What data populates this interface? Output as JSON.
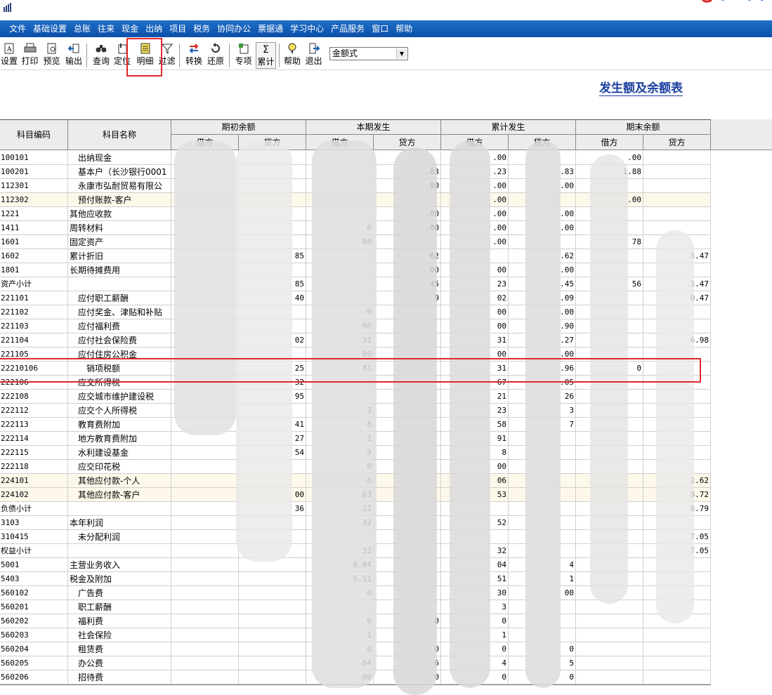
{
  "menu": [
    "文件",
    "基础设置",
    "总账",
    "往来",
    "现金",
    "出纳",
    "项目",
    "税务",
    "协同办公",
    "票据通",
    "学习中心",
    "产品服务",
    "窗口",
    "帮助"
  ],
  "toolbar": {
    "buttons": [
      {
        "label": "设置",
        "icon": "settings-icon"
      },
      {
        "label": "打印",
        "icon": "print-icon"
      },
      {
        "label": "预览",
        "icon": "preview-icon"
      },
      {
        "label": "输出",
        "icon": "export-icon"
      },
      {
        "label": "查询",
        "icon": "binoculars-icon"
      },
      {
        "label": "定位",
        "icon": "locate-icon"
      },
      {
        "label": "明细",
        "icon": "detail-icon"
      },
      {
        "label": "过滤",
        "icon": "filter-icon"
      },
      {
        "label": "转换",
        "icon": "convert-icon"
      },
      {
        "label": "还原",
        "icon": "restore-icon"
      },
      {
        "label": "专项",
        "icon": "special-icon"
      },
      {
        "label": "累计",
        "icon": "sigma-icon"
      },
      {
        "label": "帮助",
        "icon": "help-icon"
      },
      {
        "label": "退出",
        "icon": "exit-icon"
      }
    ],
    "format_select": "金额式"
  },
  "report_title": "发生额及余额表",
  "columns": {
    "code": "科目编码",
    "name": "科目名称",
    "groups": [
      "期初余额",
      "本期发生",
      "累计发生",
      "期末余额"
    ],
    "debit": "借方",
    "credit": "贷方"
  },
  "rows": [
    {
      "code": "100101",
      "name": "出纳现金",
      "v": [
        "",
        "",
        "",
        "",
        ".00",
        "",
        ".00",
        ""
      ]
    },
    {
      "code": "100201",
      "name": "基本户（长沙银行0001",
      "v": [
        "",
        "",
        "",
        ".83",
        ".23",
        ".83",
        "1.88",
        ""
      ]
    },
    {
      "code": "112301",
      "name": "永康市弘耐贸易有限公",
      "v": [
        "",
        "",
        "",
        ".00",
        ".00",
        ".00",
        "",
        ""
      ]
    },
    {
      "code": "112302",
      "name": "预付账款-客户",
      "v": [
        "",
        "",
        "",
        "",
        ".00",
        "",
        ".00",
        ""
      ]
    },
    {
      "code": "1221",
      "name": "其他应收款",
      "v": [
        "",
        "",
        "",
        ".00",
        ".00",
        ".00",
        "",
        ""
      ]
    },
    {
      "code": "1411",
      "name": "周转材料",
      "v": [
        "",
        "",
        "0",
        ".00",
        ".00",
        ".00",
        "",
        ""
      ]
    },
    {
      "code": "1601",
      "name": "固定资产",
      "v": [
        "",
        "",
        "00",
        "",
        ".00",
        "",
        "78",
        ""
      ]
    },
    {
      "code": "1602",
      "name": "累计折旧",
      "v": [
        "",
        "85",
        "",
        "62",
        "",
        ".62",
        "",
        "3.47"
      ]
    },
    {
      "code": "1801",
      "name": "长期待摊费用",
      "v": [
        "",
        "",
        "",
        "00",
        "00",
        ".00",
        "",
        ""
      ]
    },
    {
      "code": "资产小计",
      "name": "",
      "v": [
        "",
        "85",
        "",
        "45",
        "23",
        ".45",
        "56",
        "3.47"
      ]
    },
    {
      "code": "221101",
      "name": "应付职工薪酬",
      "v": [
        "",
        "40",
        "",
        "9",
        "02",
        ".09",
        "",
        "0.47"
      ]
    },
    {
      "code": "221102",
      "name": "应付奖金、津贴和补贴",
      "v": [
        "",
        "",
        "0",
        "",
        "00",
        ".00",
        "",
        ""
      ]
    },
    {
      "code": "221103",
      "name": "应付福利费",
      "v": [
        "",
        "",
        "90",
        "",
        "00",
        ".90",
        "",
        ""
      ]
    },
    {
      "code": "221104",
      "name": "应付社会保险费",
      "v": [
        "",
        "02",
        "31",
        "",
        "31",
        ".27",
        "",
        "6.98"
      ]
    },
    {
      "code": "221105",
      "name": "应付住房公积金",
      "v": [
        "",
        "",
        "00",
        "",
        "00",
        ".00",
        "",
        ""
      ]
    },
    {
      "code": "22210106",
      "name": "销项税额",
      "v": [
        "",
        "25",
        "81",
        "",
        "31",
        ".96",
        "0",
        ""
      ]
    },
    {
      "code": "222106",
      "name": "应交所得税",
      "v": [
        "",
        "32",
        "",
        "",
        "67",
        ".05",
        "",
        ""
      ]
    },
    {
      "code": "222108",
      "name": "应交城市维护建设税",
      "v": [
        "",
        "95",
        "",
        "",
        "21",
        "26",
        "",
        ""
      ]
    },
    {
      "code": "222112",
      "name": "应交个人所得税",
      "v": [
        "",
        "",
        "3",
        "",
        "23",
        "3",
        "",
        ""
      ]
    },
    {
      "code": "222113",
      "name": "教育费附加",
      "v": [
        "",
        "41",
        "8",
        "",
        "58",
        "7",
        "",
        ""
      ]
    },
    {
      "code": "222114",
      "name": "地方教育费附加",
      "v": [
        "",
        "27",
        "1",
        "",
        "91",
        "",
        "",
        ""
      ]
    },
    {
      "code": "222115",
      "name": "水利建设基金",
      "v": [
        "",
        "54",
        "9",
        "",
        "8",
        "",
        "",
        ""
      ]
    },
    {
      "code": "222118",
      "name": "应交印花税",
      "v": [
        "",
        "",
        "0",
        "",
        "00",
        "",
        "",
        ""
      ]
    },
    {
      "code": "224101",
      "name": "其他应付款-个人",
      "v": [
        "",
        "",
        "6",
        "",
        "06",
        "",
        "",
        "2.62"
      ]
    },
    {
      "code": "224102",
      "name": "其他应付款-客户",
      "v": [
        "",
        "00",
        "63",
        "",
        "53",
        "",
        "",
        "8.72"
      ]
    },
    {
      "code": "负债小计",
      "name": "",
      "v": [
        "",
        "36",
        ".21",
        "",
        "",
        "",
        "",
        "8.79"
      ]
    },
    {
      "code": "3103",
      "name": "本年利润",
      "v": [
        "",
        "",
        "32",
        "",
        "52",
        "",
        "",
        ""
      ]
    },
    {
      "code": "310415",
      "name": "未分配利润",
      "v": [
        "",
        "",
        "",
        "",
        "",
        "",
        "",
        "7.05"
      ]
    },
    {
      "code": "权益小计",
      "name": "",
      "v": [
        "",
        "",
        "32",
        "",
        "32",
        "",
        "",
        "7.05"
      ]
    },
    {
      "code": "5001",
      "name": "主营业务收入",
      "v": [
        "",
        "",
        "6.04",
        "",
        "04",
        "4",
        "",
        ""
      ]
    },
    {
      "code": "5403",
      "name": "税金及附加",
      "v": [
        "",
        "",
        "5.51",
        "",
        "51",
        "1",
        "",
        ""
      ]
    },
    {
      "code": "560102",
      "name": "广告费",
      "v": [
        "",
        "",
        "0",
        "",
        "30",
        "00",
        "",
        ""
      ]
    },
    {
      "code": "560201",
      "name": "职工薪酬",
      "v": [
        "",
        "",
        "",
        "",
        "3",
        "",
        "",
        ""
      ]
    },
    {
      "code": "560202",
      "name": "福利费",
      "v": [
        "",
        "",
        "0",
        "0",
        "0",
        "",
        "",
        ""
      ]
    },
    {
      "code": "560203",
      "name": "社会保险",
      "v": [
        "",
        "",
        ".1",
        "",
        "1",
        "",
        "",
        ""
      ]
    },
    {
      "code": "560204",
      "name": "租赁费",
      "v": [
        "",
        "",
        "0",
        "0",
        "0",
        "0",
        "",
        ""
      ]
    },
    {
      "code": "560205",
      "name": "办公费",
      "v": [
        "",
        "",
        ".64",
        "6",
        "4",
        "5",
        "",
        ""
      ]
    },
    {
      "code": "560206",
      "name": "招待费",
      "v": [
        "",
        "",
        ".00",
        "0",
        "0",
        "0",
        "",
        ""
      ]
    }
  ],
  "colors": {
    "menubar": "#0b4fa8",
    "highlight": "#e0272a",
    "title": "#1b3fa0",
    "row_highlight": "#fdf8ea"
  }
}
